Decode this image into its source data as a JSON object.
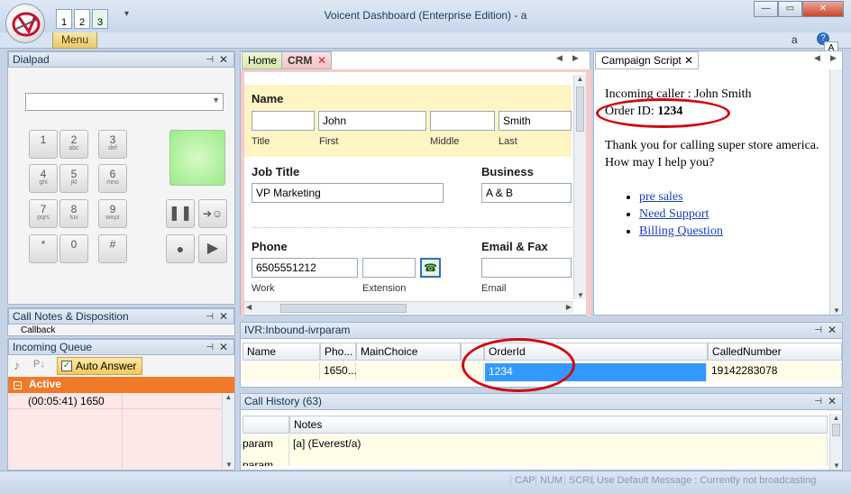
{
  "window": {
    "title": "Voicent Dashboard (Enterprise Edition) - a",
    "menu_label": "Menu",
    "qa_1": "1",
    "qa_2": "2",
    "qa_3": "3",
    "user": "a",
    "minimize": "—",
    "restore": "▭",
    "close": "✕",
    "help": "?",
    "font_a": "A"
  },
  "dialpad": {
    "title": "Dialpad",
    "keys": [
      {
        "digit": "1",
        "letters": ""
      },
      {
        "digit": "2",
        "letters": "abc"
      },
      {
        "digit": "3",
        "letters": "def"
      },
      {
        "digit": "4",
        "letters": "ghi"
      },
      {
        "digit": "5",
        "letters": "jkl"
      },
      {
        "digit": "6",
        "letters": "mno"
      },
      {
        "digit": "7",
        "letters": "pqrs"
      },
      {
        "digit": "8",
        "letters": "tuv"
      },
      {
        "digit": "9",
        "letters": "wxyz"
      },
      {
        "digit": "*",
        "letters": ""
      },
      {
        "digit": "0",
        "letters": ""
      },
      {
        "digit": "#",
        "letters": ""
      }
    ]
  },
  "notes": {
    "title": "Call Notes & Disposition",
    "callback": "Callback"
  },
  "queue": {
    "title": "Incoming Queue",
    "auto_answer": "Auto Answer",
    "active_label": "Active",
    "active_item": "(00:05:41) 1650"
  },
  "crm_tabs": {
    "home": "Home",
    "crm": "CRM"
  },
  "crm": {
    "name_header": "Name",
    "title_value": "",
    "first_value": "John",
    "middle_value": "",
    "last_value": "Smith",
    "title_label": "Title",
    "first_label": "First",
    "middle_label": "Middle",
    "last_label": "Last",
    "job_header": "Job Title",
    "job_value": "VP Marketing",
    "business_header": "Business",
    "business_value": "A & B",
    "phone_header": "Phone",
    "phone_value": "6505551212",
    "extension_value": "",
    "work_label": "Work",
    "extension_label": "Extension",
    "email_header": "Email & Fax",
    "email_value": "",
    "email_label": "Email"
  },
  "script": {
    "tab": "Campaign Script",
    "line1": "Incoming caller : John Smith",
    "order_label": "Order ID: ",
    "order_value": "1234",
    "greeting": "Thank you for calling super store america. How may I help you?",
    "links": [
      "pre sales",
      "Need Support",
      "Billing Question"
    ]
  },
  "ivr": {
    "title": "IVR:Inbound-ivrparam",
    "columns": [
      "Name",
      "Pho...",
      "MainChoice",
      "OrderId",
      "CalledNumber"
    ],
    "row": [
      "",
      "1650...",
      "",
      "1234",
      "19142283078"
    ]
  },
  "history": {
    "title": "Call History (63)",
    "notes_col": "Notes",
    "rows": [
      {
        "left": "param",
        "notes": "[a] (Everest/a)"
      },
      {
        "left": "param",
        "notes": ""
      }
    ]
  },
  "statusbar": {
    "cap": "CAP",
    "num": "NUM",
    "scrl": "SCRL",
    "message": "Use Default Message : Currently not broadcasting"
  },
  "colors": {
    "accent": "#f07a2a",
    "highlight": "#3399ff",
    "annotation": "#d10a10"
  }
}
